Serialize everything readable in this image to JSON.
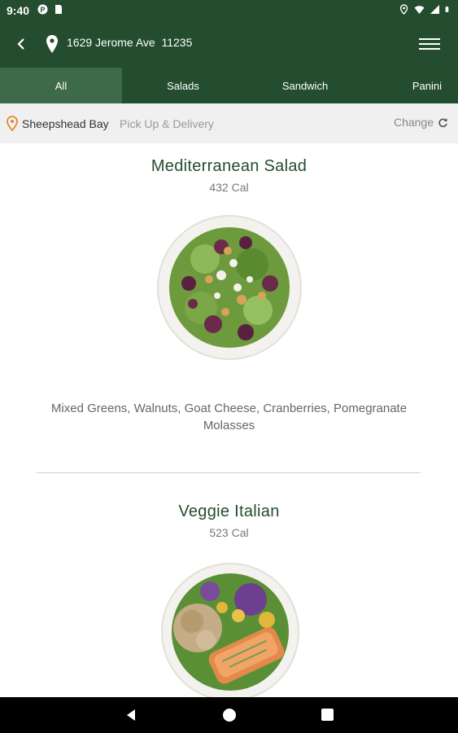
{
  "status": {
    "time": "9:40"
  },
  "header": {
    "address": "1629 Jerome Ave  11235"
  },
  "tabs": [
    {
      "label": "All",
      "active": true
    },
    {
      "label": "Salads",
      "active": false
    },
    {
      "label": "Sandwich",
      "active": false
    },
    {
      "label": "Panini",
      "active": false
    }
  ],
  "store": {
    "name": "Sheepshead Bay",
    "mode": "Pick Up & Delivery",
    "change_label": "Change"
  },
  "menu_items": [
    {
      "name": "Mediterranean Salad",
      "calories": "432 Cal",
      "description": "Mixed Greens, Walnuts, Goat Cheese, Cranberries, Pomegranate Molasses"
    },
    {
      "name": "Veggie Italian",
      "calories": "523 Cal"
    }
  ],
  "colors": {
    "primary": "#244c2f",
    "active_tab": "#3d6a49",
    "store_pin": "#e8872e"
  }
}
